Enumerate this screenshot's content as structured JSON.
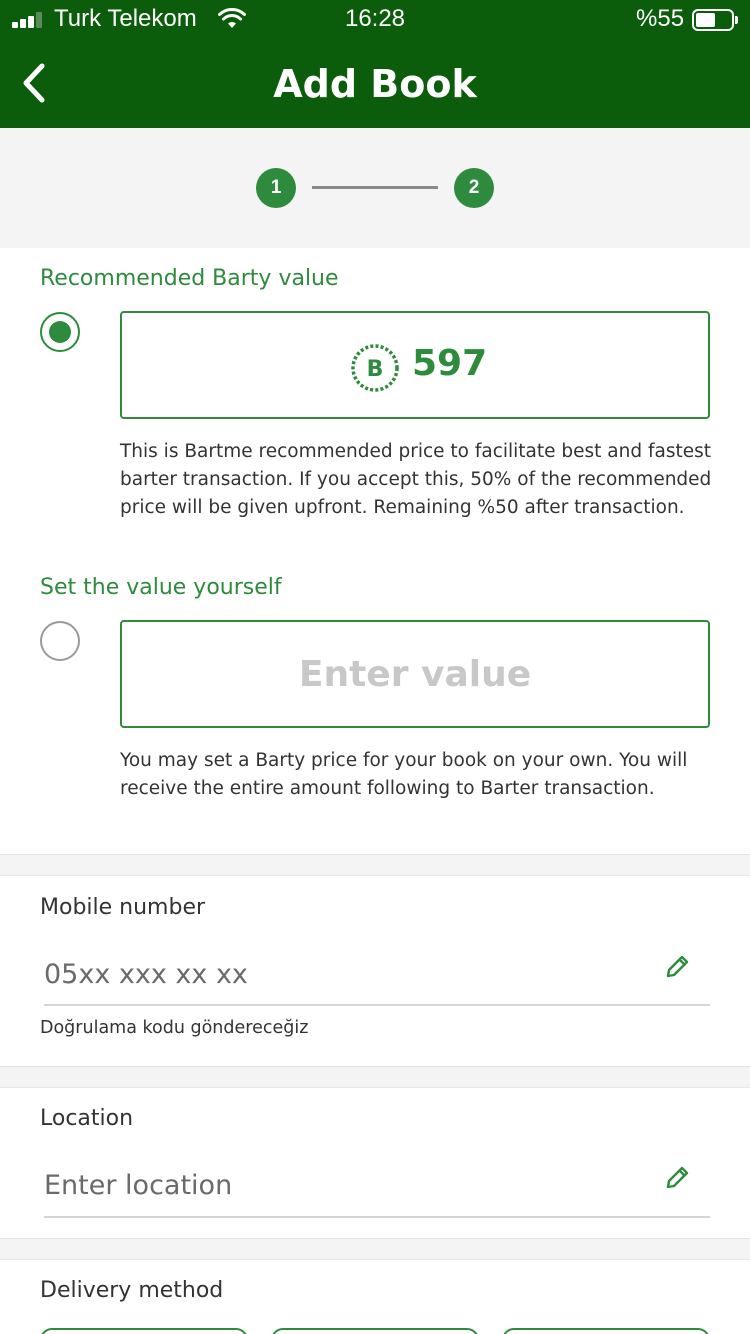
{
  "status_bar": {
    "carrier": "Turk Telekom",
    "time": "16:28",
    "battery_percent": "%55",
    "battery_level": 0.55,
    "signal_bars_active": 3,
    "icons": [
      "signal-icon",
      "wifi-icon",
      "battery-icon"
    ]
  },
  "header": {
    "title": "Add Book",
    "back_icon": "chevron-left-icon"
  },
  "stepper": {
    "steps": [
      "1",
      "2"
    ],
    "current": 2
  },
  "value_section": {
    "recommended_label": "Recommended Barty value",
    "recommended_value": "597",
    "coin_icon_letter": "B",
    "recommended_selected": true,
    "recommended_desc": "This is Bartme recommended price to facilitate best and fastest barter transaction. If you accept this, 50% of the recommended price will be given upfront. Remaining %50 after transaction.",
    "custom_label": "Set the value yourself",
    "custom_placeholder": "Enter value",
    "custom_selected": false,
    "custom_desc": "You may set a Barty price for your book on your own. You will receive the entire amount following to Barter transaction."
  },
  "mobile": {
    "label": "Mobile number",
    "placeholder": "05xx xxx xx xx",
    "hint": "Doğrulama kodu göndereceğiz",
    "edit_icon": "pencil-icon"
  },
  "location": {
    "label": "Location",
    "placeholder": "Enter location",
    "edit_icon": "pencil-icon"
  },
  "delivery": {
    "label": "Delivery method"
  },
  "colors": {
    "header_green": "#0b5c0b",
    "accent_green": "#2e8b3d",
    "background_gray": "#f4f4f4"
  }
}
